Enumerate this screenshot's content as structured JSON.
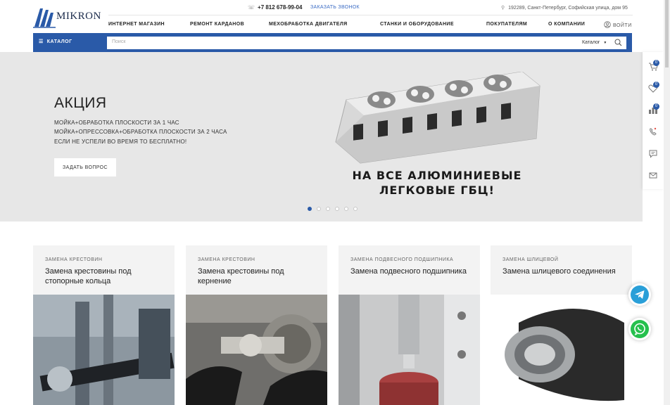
{
  "header": {
    "logo_text": "MIKRON",
    "phone": "+7 812 678-99-04",
    "callback": "ЗАКАЗАТЬ ЗВОНОК",
    "address": "192289, Санкт-Петербург, Софийская улица, дом 95",
    "login": "ВОЙТИ",
    "nav": [
      {
        "label": "ИНТЕРНЕТ МАГАЗИН"
      },
      {
        "label": "РЕМОНТ КАРДАНОВ"
      },
      {
        "label": "МЕХОБРАБОТКА ДВИГАТЕЛЯ"
      },
      {
        "label": "СТАНКИ И ОБОРУДОВАНИЕ"
      },
      {
        "label": "ПОКУПАТЕЛЯМ"
      },
      {
        "label": "О КОМПАНИИ"
      }
    ]
  },
  "search": {
    "catalog_label": "КАТАЛОГ",
    "placeholder": "Поиск",
    "scope": "Каталог"
  },
  "hero": {
    "title": "АКЦИЯ",
    "lines": [
      "МОЙКА+ОБРАБОТКА ПЛОСКОСТИ ЗА 1 ЧАС",
      "МОЙКА+ОПРЕССОВКА+ОБРАБОТКА ПЛОСКОСТИ ЗА 2 ЧАСА",
      "ЕСЛИ НЕ УСПЕЛИ ВО ВРЕМЯ ТО БЕСПЛАТНО!"
    ],
    "button": "ЗАДАТЬ ВОПРОС",
    "promo_line1": "НА ВСЕ АЛЮМИНИЕВЫЕ",
    "promo_line2": "ЛЕГКОВЫЕ ГБЦ!",
    "slides_count": 6,
    "active_slide": 1
  },
  "sidebar": {
    "cart_count": "0",
    "favorites_count": "0",
    "compare_count": "0"
  },
  "cards": [
    {
      "category": "ЗАМЕНА КРЕСТОВИН",
      "title": "Замена крестовины под стопорные кольца"
    },
    {
      "category": "ЗАМЕНА КРЕСТОВИН",
      "title": "Замена крестовины под кернение"
    },
    {
      "category": "ЗАМЕНА ПОДВЕСНОГО ПОДШИПНИКА",
      "title": "Замена подвесного подшипника"
    },
    {
      "category": "ЗАМЕНА ШЛИЦЕВОЙ",
      "title": "Замена шлицевого соединения"
    }
  ],
  "colors": {
    "brand_blue": "#2a5aa8",
    "telegram": "#2a9fd8",
    "whatsapp": "#25c04d"
  }
}
